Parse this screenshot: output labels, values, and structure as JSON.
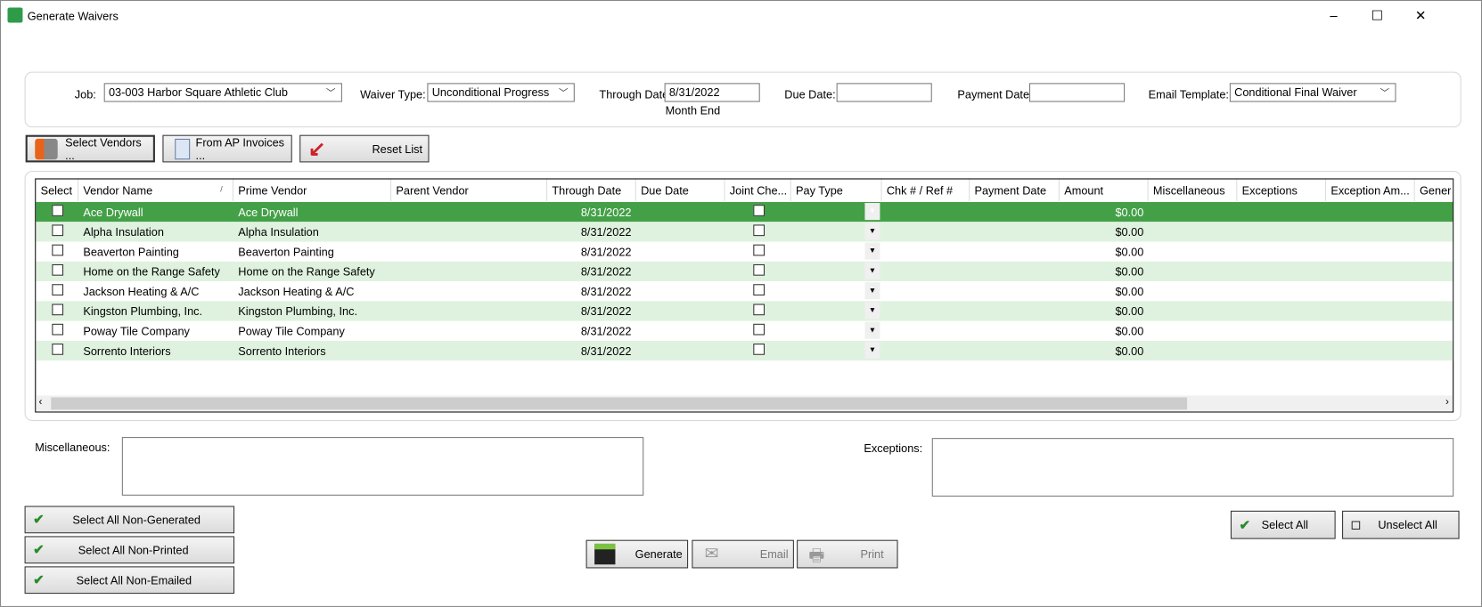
{
  "window": {
    "title": "Generate Waivers",
    "minimize": "–",
    "maximize": "☐",
    "close": "✕"
  },
  "filters": {
    "job_label": "Job:",
    "job_value": "03-003  Harbor Square Athletic Club",
    "waiver_type_label": "Waiver Type:",
    "waiver_type_value": "Unconditional Progress",
    "through_date_label": "Through Date:",
    "through_date_value": "8/31/2022",
    "through_date_hint": "Month End",
    "due_date_label": "Due Date:",
    "due_date_value": "",
    "payment_date_label": "Payment Date:",
    "payment_date_value": "",
    "email_template_label": "Email Template:",
    "email_template_value": "Conditional Final Waiver"
  },
  "toolbar": {
    "select_vendors": "Select Vendors ...",
    "from_ap_invoices": "From AP Invoices ...",
    "reset_list": "Reset List"
  },
  "grid": {
    "columns": [
      "Select",
      "Vendor Name",
      "Prime Vendor",
      "Parent Vendor",
      "Through Date",
      "Due Date",
      "Joint Che...",
      "Pay Type",
      "Chk # / Ref #",
      "Payment Date",
      "Amount",
      "Miscellaneous",
      "Exceptions",
      "Exception Am...",
      "Gener"
    ],
    "sort_indicator": "/",
    "rows": [
      {
        "vendor": "Ace Drywall",
        "prime": "Ace Drywall",
        "parent": "",
        "through": "8/31/2022",
        "amount": "$0.00",
        "selected": true
      },
      {
        "vendor": "Alpha Insulation",
        "prime": "Alpha Insulation",
        "parent": "",
        "through": "8/31/2022",
        "amount": "$0.00"
      },
      {
        "vendor": "Beaverton Painting",
        "prime": "Beaverton Painting",
        "parent": "",
        "through": "8/31/2022",
        "amount": "$0.00"
      },
      {
        "vendor": "Home on the Range Safety",
        "prime": "Home on the Range Safety",
        "parent": "",
        "through": "8/31/2022",
        "amount": "$0.00"
      },
      {
        "vendor": "Jackson Heating & A/C",
        "prime": "Jackson Heating & A/C",
        "parent": "",
        "through": "8/31/2022",
        "amount": "$0.00"
      },
      {
        "vendor": "Kingston Plumbing, Inc.",
        "prime": "Kingston Plumbing, Inc.",
        "parent": "",
        "through": "8/31/2022",
        "amount": "$0.00"
      },
      {
        "vendor": "Poway Tile Company",
        "prime": "Poway Tile Company",
        "parent": "",
        "through": "8/31/2022",
        "amount": "$0.00"
      },
      {
        "vendor": "Sorrento Interiors",
        "prime": "Sorrento Interiors",
        "parent": "",
        "through": "8/31/2022",
        "amount": "$0.00"
      }
    ],
    "colors": {
      "selected": "#43a047",
      "alt": "#dff2df"
    }
  },
  "notes": {
    "misc_label": "Miscellaneous:",
    "exceptions_label": "Exceptions:"
  },
  "actions": {
    "select_non_generated": "Select All Non-Generated",
    "select_non_printed": "Select All Non-Printed",
    "select_non_emailed": "Select All Non-Emailed",
    "generate": "Generate",
    "email": "Email",
    "print": "Print",
    "select_all": "Select All",
    "unselect_all": "Unselect All"
  }
}
